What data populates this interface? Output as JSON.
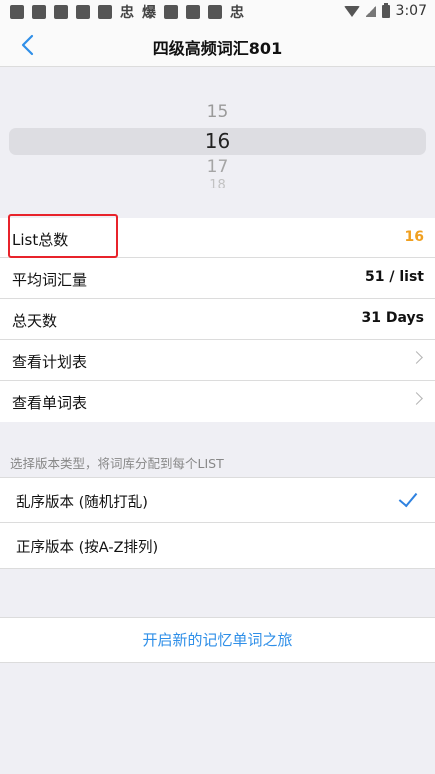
{
  "statusbar": {
    "time": "3:07",
    "glyph_chong_1": "忠",
    "glyph_bao": "爆",
    "glyph_chong_2": "忠"
  },
  "nav": {
    "title": "四级高频词汇801"
  },
  "picker": {
    "above": "15",
    "selected": "16",
    "below": "17",
    "below2": "18"
  },
  "settings": {
    "list_total": {
      "label": "List总数",
      "value": "16"
    },
    "avg_words": {
      "label": "平均词汇量",
      "value": "51 / list"
    },
    "total_days": {
      "label": "总天数",
      "value": "31 Days"
    },
    "view_plan": {
      "label": "查看计划表"
    },
    "view_words": {
      "label": "查看单词表"
    }
  },
  "version": {
    "header": "选择版本类型，将词库分配到每个LIST",
    "options": [
      {
        "label": "乱序版本 (随机打乱)",
        "selected": true
      },
      {
        "label": "正序版本 (按A-Z排列)",
        "selected": false
      }
    ]
  },
  "start_button": "开启新的记忆单词之旅",
  "colors": {
    "accent": "#2f8fe8",
    "value_highlight": "#f0a020",
    "annotation_box": "#e8232b"
  }
}
